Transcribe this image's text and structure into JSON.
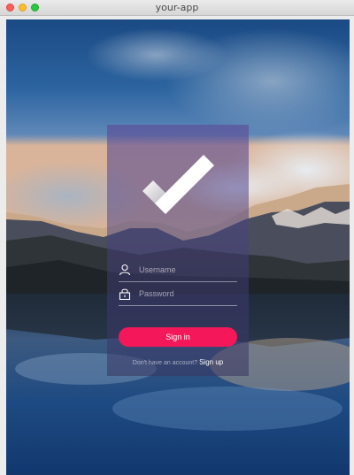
{
  "window": {
    "title": "your-app"
  },
  "login": {
    "username_placeholder": "Username",
    "password_placeholder": "Password",
    "signin_label": "Sign in",
    "no_account_text": "Don't have an account?",
    "signup_label": "Sign up"
  },
  "icons": {
    "logo": "checkmark-logo-icon",
    "username": "user-icon",
    "password": "lock-icon"
  },
  "colors": {
    "accent": "#f4185a"
  }
}
